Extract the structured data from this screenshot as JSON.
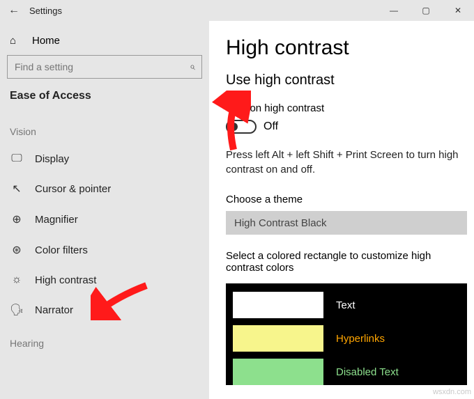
{
  "titlebar": {
    "back": "←",
    "title": "Settings",
    "min": "—",
    "max": "▢",
    "close": "✕"
  },
  "sidebar": {
    "home": "Home",
    "search_placeholder": "Find a setting",
    "group": "Ease of Access",
    "vision_head": "Vision",
    "items": [
      {
        "icon": "🖵",
        "label": "Display"
      },
      {
        "icon": "↖",
        "label": "Cursor & pointer"
      },
      {
        "icon": "⊕",
        "label": "Magnifier"
      },
      {
        "icon": "⊛",
        "label": "Color filters"
      },
      {
        "icon": "☼",
        "label": "High contrast"
      },
      {
        "icon": "🗣",
        "label": "Narrator"
      }
    ],
    "hearing_head": "Hearing"
  },
  "content": {
    "h1": "High contrast",
    "h2": "Use high contrast",
    "toggle_label": "Turn on high contrast",
    "toggle_state": "Off",
    "hint": "Press left Alt + left Shift + Print Screen to turn high contrast on and off.",
    "theme_label": "Choose a theme",
    "theme_value": "High Contrast Black",
    "customize_label": "Select a colored rectangle to customize high contrast colors",
    "swatches": [
      {
        "color": "#ffffff",
        "label": "Text",
        "label_color": "#ffffff"
      },
      {
        "color": "#f7f58c",
        "label": "Hyperlinks",
        "label_color": "#ffa500"
      },
      {
        "color": "#8de08d",
        "label": "Disabled Text",
        "label_color": "#8de08d"
      }
    ]
  },
  "watermark": "wsxdn.com"
}
